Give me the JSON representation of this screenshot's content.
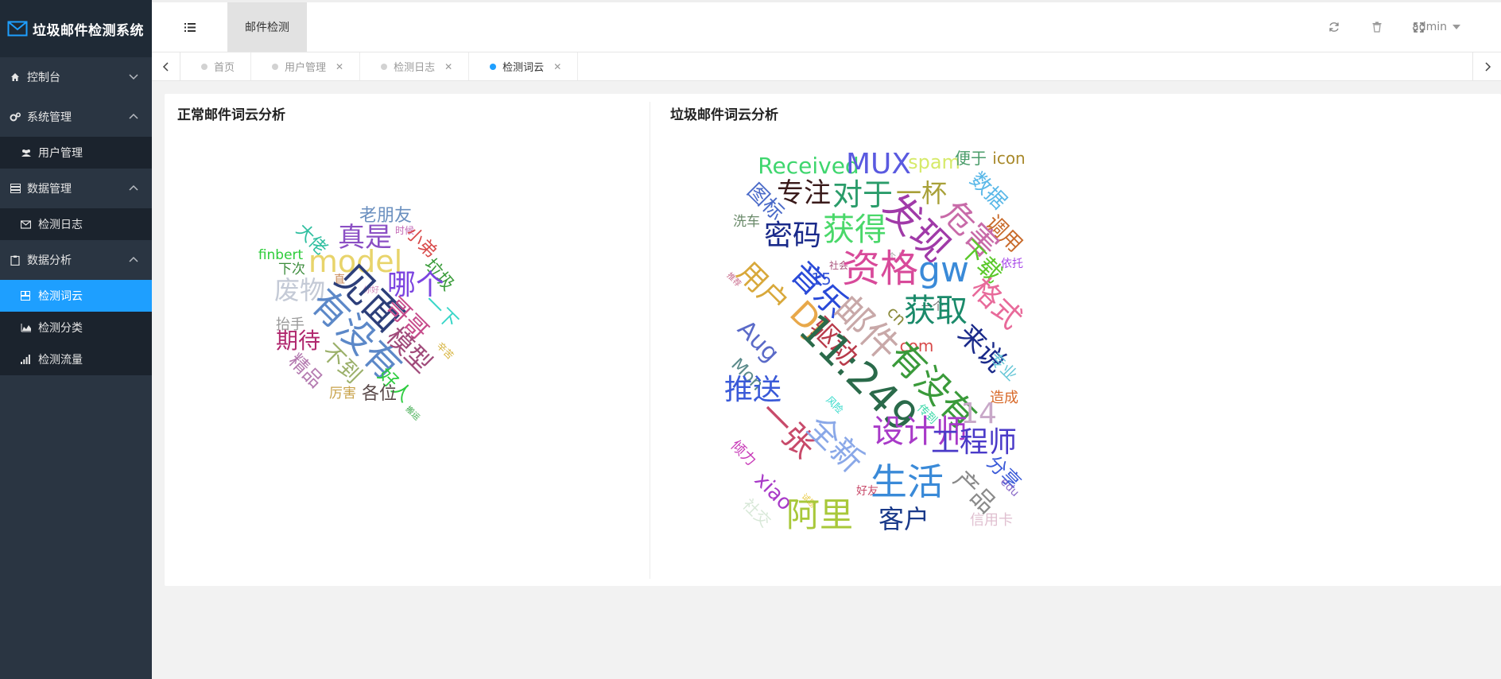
{
  "app": {
    "title": "垃圾邮件检测系统"
  },
  "sidebar": {
    "items": [
      {
        "label": "控制台"
      },
      {
        "label": "系统管理"
      },
      {
        "label": "用户管理"
      },
      {
        "label": "数据管理"
      },
      {
        "label": "检测日志"
      },
      {
        "label": "数据分析"
      },
      {
        "label": "检测词云"
      },
      {
        "label": "检测分类"
      },
      {
        "label": "检测流量"
      }
    ]
  },
  "header": {
    "tab_label": "邮件检测",
    "user": "admin"
  },
  "tabs": [
    {
      "label": "首页"
    },
    {
      "label": "用户管理"
    },
    {
      "label": "检测日志"
    },
    {
      "label": "检测词云"
    }
  ],
  "panels": {
    "normal_title": "正常邮件词云分析",
    "spam_title": "垃圾邮件词云分析"
  },
  "colors": {
    "accent": "#1e9fff",
    "sidebar": "#2a3542",
    "sidebar_dark": "#1b232d"
  },
  "wordclouds": {
    "normal": [
      {
        "t": "老朋友",
        "c": "#6a8fbf"
      },
      {
        "t": "时候",
        "c": "#c266b5"
      },
      {
        "t": "大佬",
        "c": "#2fbfa0"
      },
      {
        "t": "真是",
        "c": "#8b4fc4"
      },
      {
        "t": "小弟",
        "c": "#d94a4a"
      },
      {
        "t": "finbert",
        "c": "#2dcc3a"
      },
      {
        "t": "model",
        "c": "#e8d46b"
      },
      {
        "t": "下次",
        "c": "#3c8c3c"
      },
      {
        "t": "直",
        "c": "#c98a5a"
      },
      {
        "t": "你好",
        "c": "#d08ab8"
      },
      {
        "t": "垃圾",
        "c": "#3a9c3a"
      },
      {
        "t": "哪个",
        "c": "#7b44e0"
      },
      {
        "t": "废物",
        "c": "#c4cad6"
      },
      {
        "t": "见面",
        "c": "#2d3f7a"
      },
      {
        "t": "一下",
        "c": "#39d6c8"
      },
      {
        "t": "哥哥",
        "c": "#c64a8a"
      },
      {
        "t": "抬手",
        "c": "#9a9a9a"
      },
      {
        "t": "有没有",
        "c": "#5c88c8"
      },
      {
        "t": "期待",
        "c": "#b0286e"
      },
      {
        "t": "模型",
        "c": "#a04a7a"
      },
      {
        "t": "辛苦",
        "c": "#d6b23a"
      },
      {
        "t": "不到",
        "c": "#9bb06a"
      },
      {
        "t": "精品",
        "c": "#b47ab0"
      },
      {
        "t": "好人",
        "c": "#2ecc40"
      },
      {
        "t": "厉害",
        "c": "#c8a24a"
      },
      {
        "t": "各位",
        "c": "#5a4a4a"
      },
      {
        "t": "搬运",
        "c": "#3aa84a"
      }
    ],
    "spam": [
      {
        "t": "Received",
        "c": "#3fd66e"
      },
      {
        "t": "MUX",
        "c": "#5a5ae0"
      },
      {
        "t": "spam",
        "c": "#d6ea6a"
      },
      {
        "t": "便于",
        "c": "#4a9c6a"
      },
      {
        "t": "icon",
        "c": "#a8892a"
      },
      {
        "t": "图标",
        "c": "#4a6ac8"
      },
      {
        "t": "专注",
        "c": "#3a1a1a"
      },
      {
        "t": "对于",
        "c": "#2a9c6a"
      },
      {
        "t": "一杯",
        "c": "#a8a038"
      },
      {
        "t": "数据",
        "c": "#5ab8e8"
      },
      {
        "t": "洗车",
        "c": "#6a8a6a"
      },
      {
        "t": "密码",
        "c": "#1a2a8a"
      },
      {
        "t": "获得",
        "c": "#4ad86a"
      },
      {
        "t": "发现",
        "c": "#a03aa8"
      },
      {
        "t": "危害",
        "c": "#c86aa8"
      },
      {
        "t": "调用",
        "c": "#c86a2a"
      },
      {
        "t": "下载",
        "c": "#5ac82a"
      },
      {
        "t": "依托",
        "c": "#a84ae8"
      },
      {
        "t": "个人",
        "c": "#9a9a9a"
      },
      {
        "t": "社会",
        "c": "#a8507a"
      },
      {
        "t": "15",
        "c": "#3a5ad8"
      },
      {
        "t": "资格",
        "c": "#d84a9a"
      },
      {
        "t": "gw",
        "c": "#3a8ad8"
      },
      {
        "t": "用户",
        "c": "#d8a83a"
      },
      {
        "t": "推荐",
        "c": "#c86a8a"
      },
      {
        "t": "音乐",
        "c": "#2a4ad8"
      },
      {
        "t": "一个",
        "c": "#6a6a6a"
      },
      {
        "t": "格式",
        "c": "#e86a9a"
      },
      {
        "t": "获取",
        "c": "#1a8a6a"
      },
      {
        "t": "DJ",
        "c": "#e8a84a"
      },
      {
        "t": "cn",
        "c": "#8a8a3a"
      },
      {
        "t": "邮件",
        "c": "#c8a8a8"
      },
      {
        "t": "Aug",
        "c": "#5a6ac8"
      },
      {
        "t": "驱动",
        "c": "#b83a4a"
      },
      {
        "t": "com",
        "c": "#d84a4a"
      },
      {
        "t": "来说",
        "c": "#1a2a8a"
      },
      {
        "t": "专业",
        "c": "#6ac8d8"
      },
      {
        "t": "Mon",
        "c": "#5a8a8a"
      },
      {
        "t": "11:249",
        "c": "#2a6a4a"
      },
      {
        "t": "有没有",
        "c": "#3a9a3a"
      },
      {
        "t": "推送",
        "c": "#3a5ad8"
      },
      {
        "t": "造成",
        "c": "#d86a2a"
      },
      {
        "t": "风险",
        "c": "#2ad8c8"
      },
      {
        "t": "传到",
        "c": "#3ad8a8"
      },
      {
        "t": "14",
        "c": "#c8a8c8"
      },
      {
        "t": "一张",
        "c": "#c84a6a"
      },
      {
        "t": "全新",
        "c": "#8aa8e8"
      },
      {
        "t": "设计师",
        "c": "#a83ac8"
      },
      {
        "t": "工程师",
        "c": "#4a3ac8"
      },
      {
        "t": "倾力",
        "c": "#c83ab8"
      },
      {
        "t": "分享",
        "c": "#3a5ad8"
      },
      {
        "t": "edu",
        "c": "#8a6ac8"
      },
      {
        "t": "xiao",
        "c": "#a83ac8"
      },
      {
        "t": "好友",
        "c": "#c84a6a"
      },
      {
        "t": "试题",
        "c": "#e8c83a"
      },
      {
        "t": "生活",
        "c": "#3a8ad8"
      },
      {
        "t": "产品",
        "c": "#8a8a8a"
      },
      {
        "t": "社交",
        "c": "#d8e8d8"
      },
      {
        "t": "阿里",
        "c": "#a8c83a"
      },
      {
        "t": "客户",
        "c": "#1a3a8a"
      },
      {
        "t": "信用卡",
        "c": "#e0c0d0"
      },
      {
        "t": "0800",
        "c": "#b06ac8"
      },
      {
        "t": "字体",
        "c": "#3a5a8a"
      }
    ]
  }
}
